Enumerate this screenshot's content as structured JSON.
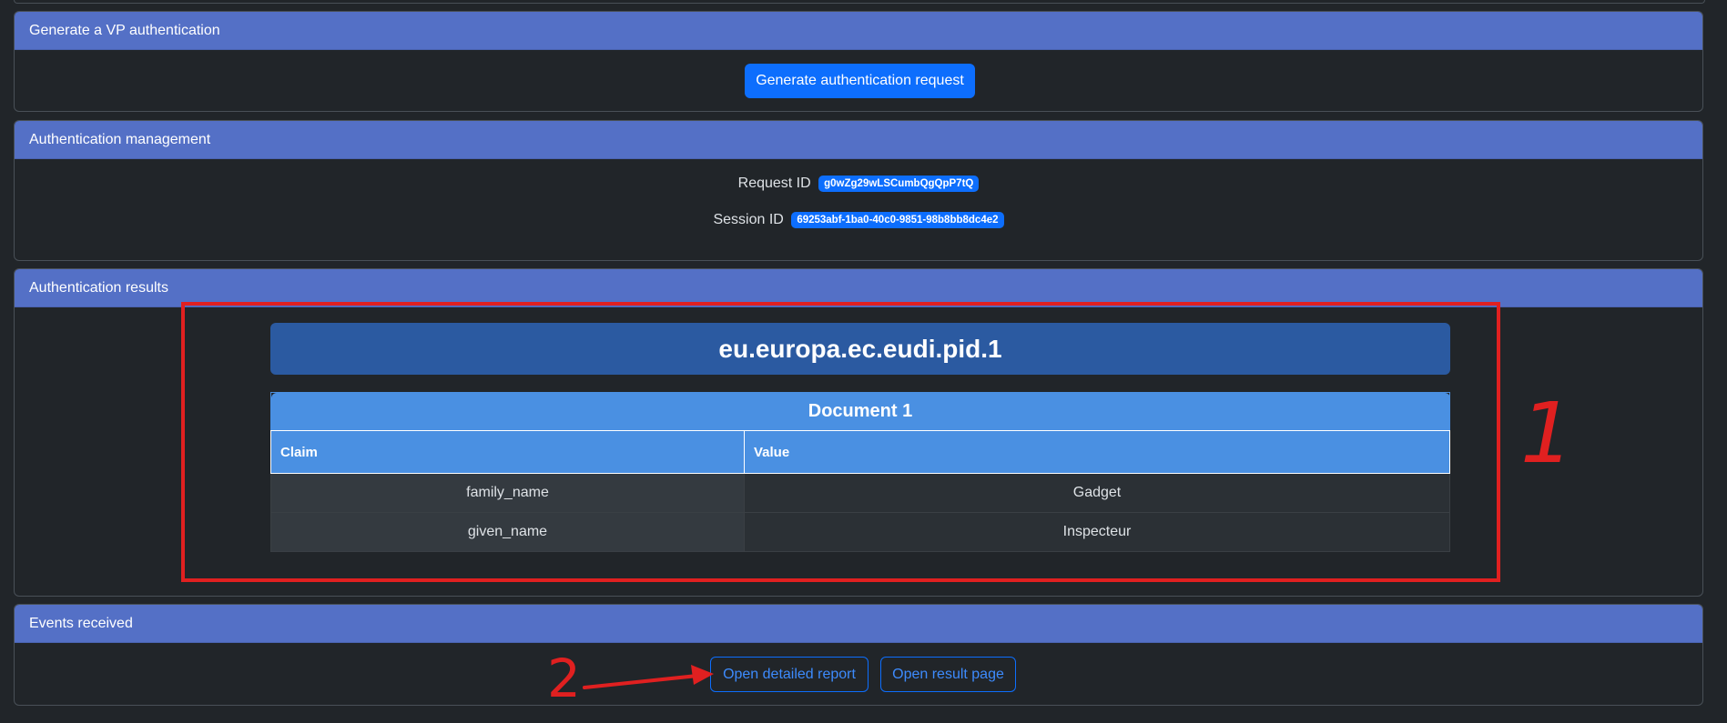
{
  "generate_card": {
    "header": "Generate a VP authentication",
    "button_label": "Generate authentication request"
  },
  "management_card": {
    "header": "Authentication management",
    "request_id_label": "Request ID",
    "request_id_value": "g0wZg29wLSCumbQgQpP7tQ",
    "session_id_label": "Session ID",
    "session_id_value": "69253abf-1ba0-40c0-9851-98b8bb8dc4e2"
  },
  "results_card": {
    "header": "Authentication results",
    "doc_type": "eu.europa.ec.eudi.pid.1",
    "document_title": "Document 1",
    "columns": [
      "Claim",
      "Value"
    ],
    "rows": [
      {
        "claim": "family_name",
        "value": "Gadget"
      },
      {
        "claim": "given_name",
        "value": "Inspecteur"
      }
    ]
  },
  "events_card": {
    "header": "Events received",
    "detailed_report_label": "Open detailed report",
    "result_page_label": "Open result page"
  },
  "annotations": {
    "label_1": "1",
    "label_2": "2",
    "color": "#e02020"
  },
  "colors": {
    "background": "#212529",
    "card_header": "#5470c6",
    "primary": "#0d6efd",
    "doc_type_bg": "#2b5aa1",
    "table_header": "#4a90e2"
  }
}
